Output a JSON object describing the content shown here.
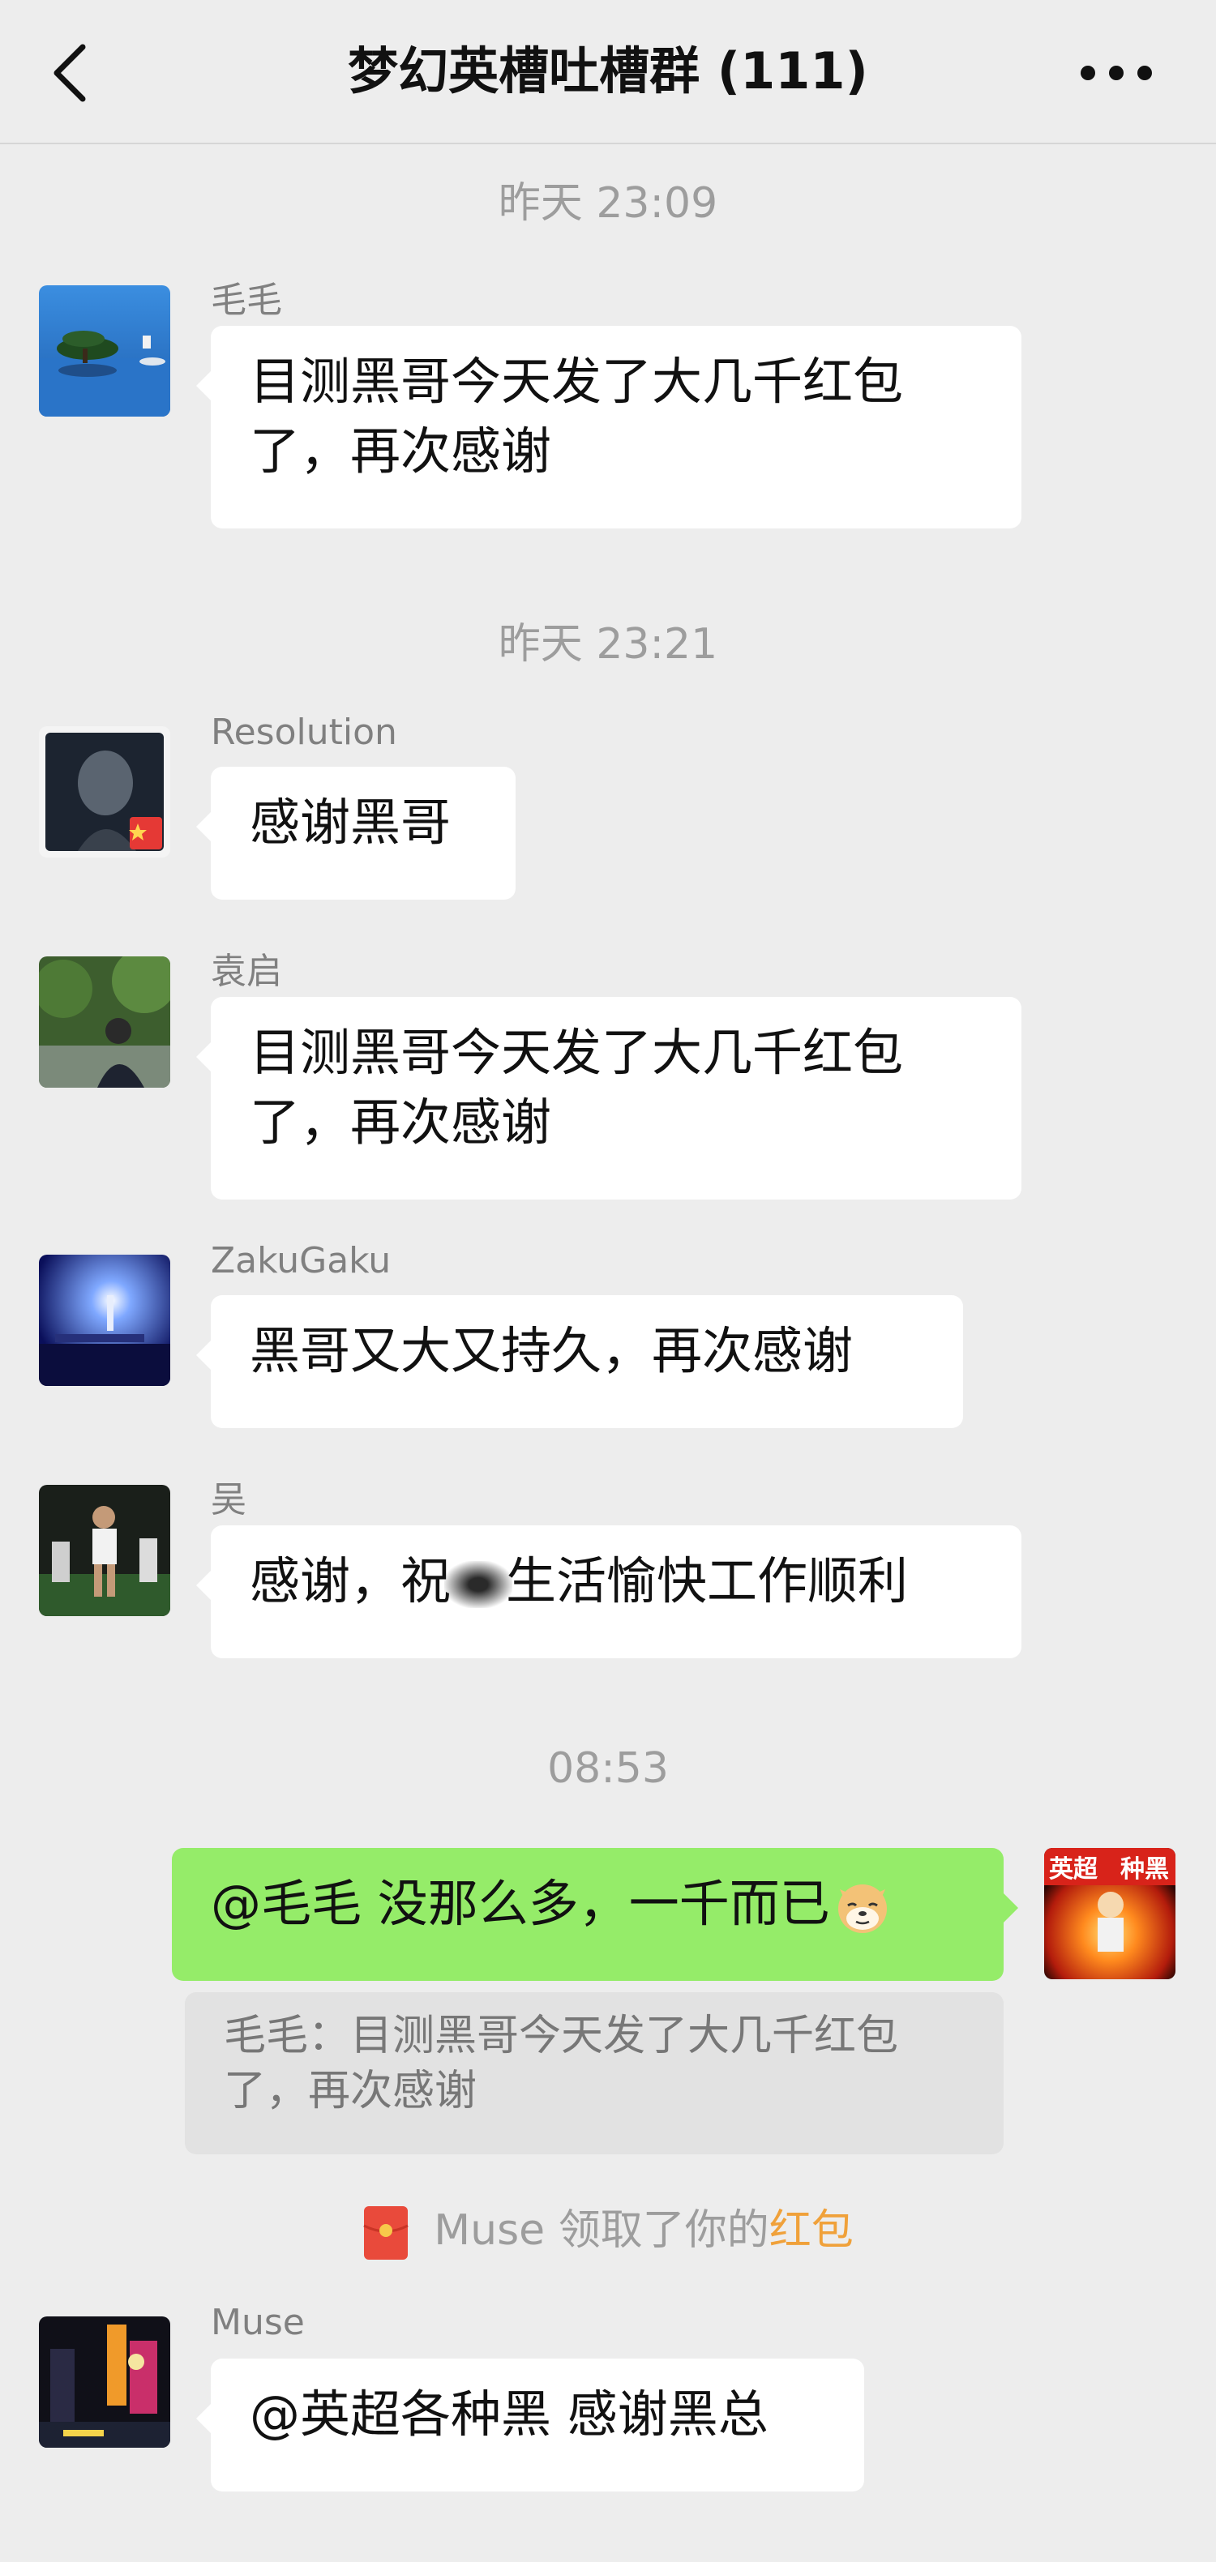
{
  "header": {
    "title": "梦幻英槽吐槽群 (111)"
  },
  "messages": [
    {
      "time": "昨天 23:09",
      "sender": "毛毛",
      "text_line1": "目测黑哥今天发了大几千红包",
      "text_line2": "了，再次感谢"
    },
    {
      "time": "昨天 23:21",
      "sender": "Resolution",
      "text": "感谢黑哥"
    },
    {
      "sender": "袁启",
      "text_line1": "目测黑哥今天发了大几千红包",
      "text_line2": "了，再次感谢"
    },
    {
      "sender": "ZakuGaku",
      "text": "黑哥又大又持久，再次感谢"
    },
    {
      "sender": "吴",
      "text_before": "感谢，祝",
      "text_after": "生活愉快工作顺利"
    },
    {
      "time": "08:53",
      "text": "@毛毛 没那么多，一千而已",
      "quote_line1": "毛毛：目测黑哥今天发了大几千红包",
      "quote_line2": "了，再次感谢"
    },
    {
      "sender": "Muse",
      "text": "@英超各种黑 感谢黑总"
    }
  ],
  "system_note": {
    "prefix": "Muse 领取了你的",
    "link": "红包"
  },
  "my_avatar": {
    "text_left": "英超",
    "text_right": "种黑"
  },
  "colors": {
    "background": "#ededed",
    "bubble_white": "#ffffff",
    "bubble_green": "#95ec69",
    "quote_bg": "#e2e2e2",
    "system_link": "#f0a13a"
  },
  "icons": [
    "back-arrow-icon",
    "more-dots-icon",
    "red-packet-icon",
    "dog-emoji-icon"
  ]
}
